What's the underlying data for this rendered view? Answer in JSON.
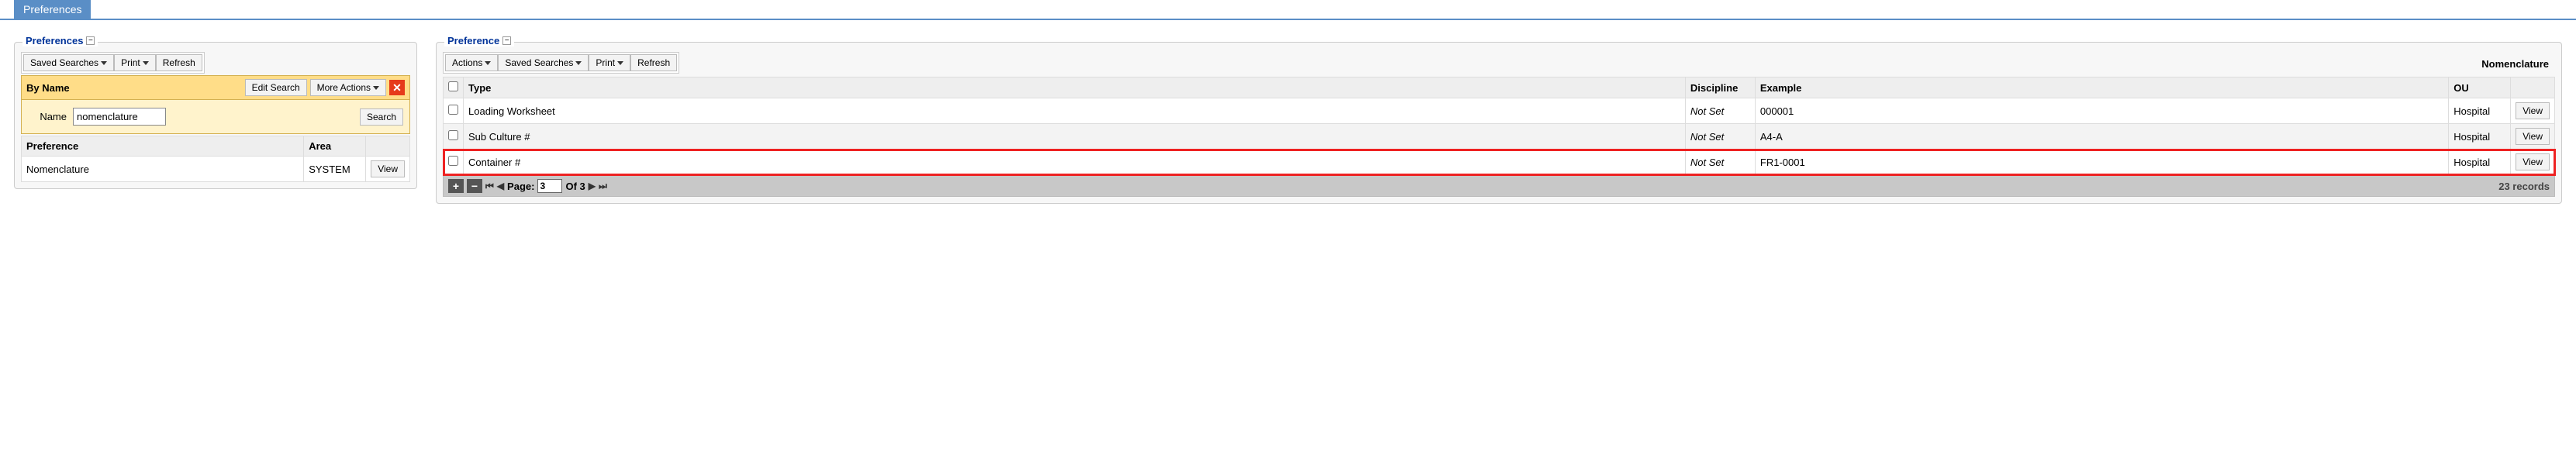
{
  "tab": {
    "label": "Preferences"
  },
  "left": {
    "legend": "Preferences",
    "toolbar": {
      "saved_searches": "Saved Searches",
      "print": "Print",
      "refresh": "Refresh"
    },
    "search": {
      "title": "By Name",
      "edit": "Edit Search",
      "more": "More Actions",
      "name_label": "Name",
      "name_value": "nomenclature",
      "search_btn": "Search"
    },
    "table": {
      "headers": {
        "preference": "Preference",
        "area": "Area"
      },
      "row": {
        "preference": "Nomenclature",
        "area": "SYSTEM",
        "view": "View"
      }
    }
  },
  "right": {
    "legend": "Preference",
    "toolbar": {
      "actions": "Actions",
      "saved_searches": "Saved Searches",
      "print": "Print",
      "refresh": "Refresh",
      "context_label": "Nomenclature"
    },
    "table": {
      "headers": {
        "type": "Type",
        "discipline": "Discipline",
        "example": "Example",
        "ou": "OU"
      },
      "rows": [
        {
          "type": "Loading Worksheet",
          "discipline": "Not Set",
          "example": "000001",
          "ou": "Hospital",
          "view": "View",
          "highlight": false,
          "alt": false
        },
        {
          "type": "Sub Culture #",
          "discipline": "Not Set",
          "example": "A4-A",
          "ou": "Hospital",
          "view": "View",
          "highlight": false,
          "alt": true
        },
        {
          "type": "Container #",
          "discipline": "Not Set",
          "example": "FR1-0001",
          "ou": "Hospital",
          "view": "View",
          "highlight": true,
          "alt": false
        }
      ]
    },
    "pager": {
      "page_label": "Page:",
      "page_value": "3",
      "of_label": "Of 3",
      "records": "23 records"
    }
  }
}
